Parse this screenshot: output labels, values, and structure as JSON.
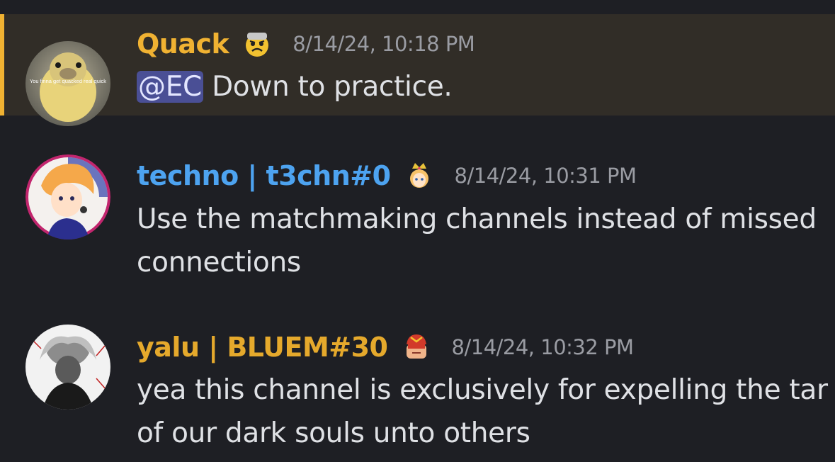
{
  "messages": [
    {
      "author": "Quack",
      "author_color": "#f0b232",
      "badge_icon": "angry-face-badge-icon",
      "timestamp": "8/14/24, 10:18 PM",
      "avatar_caption": "You finna get quacked real quick",
      "mention": "@EC",
      "text": " Down to practice.",
      "highlighted": true
    },
    {
      "author": "techno | t3chn#0",
      "author_color": "#4da3f0",
      "badge_icon": "princess-peach-badge-icon",
      "timestamp": "8/14/24, 10:31 PM",
      "lines": [
        "Use the matchmaking channels instead of missed",
        "connections"
      ]
    },
    {
      "author": "yalu | BLUEM#30",
      "author_color": "#e5a92c",
      "badge_icon": "captain-falcon-badge-icon",
      "timestamp": "8/14/24, 10:32 PM",
      "lines": [
        "yea this channel is exclusively for expelling the tar",
        "of our dark souls unto others"
      ]
    }
  ]
}
